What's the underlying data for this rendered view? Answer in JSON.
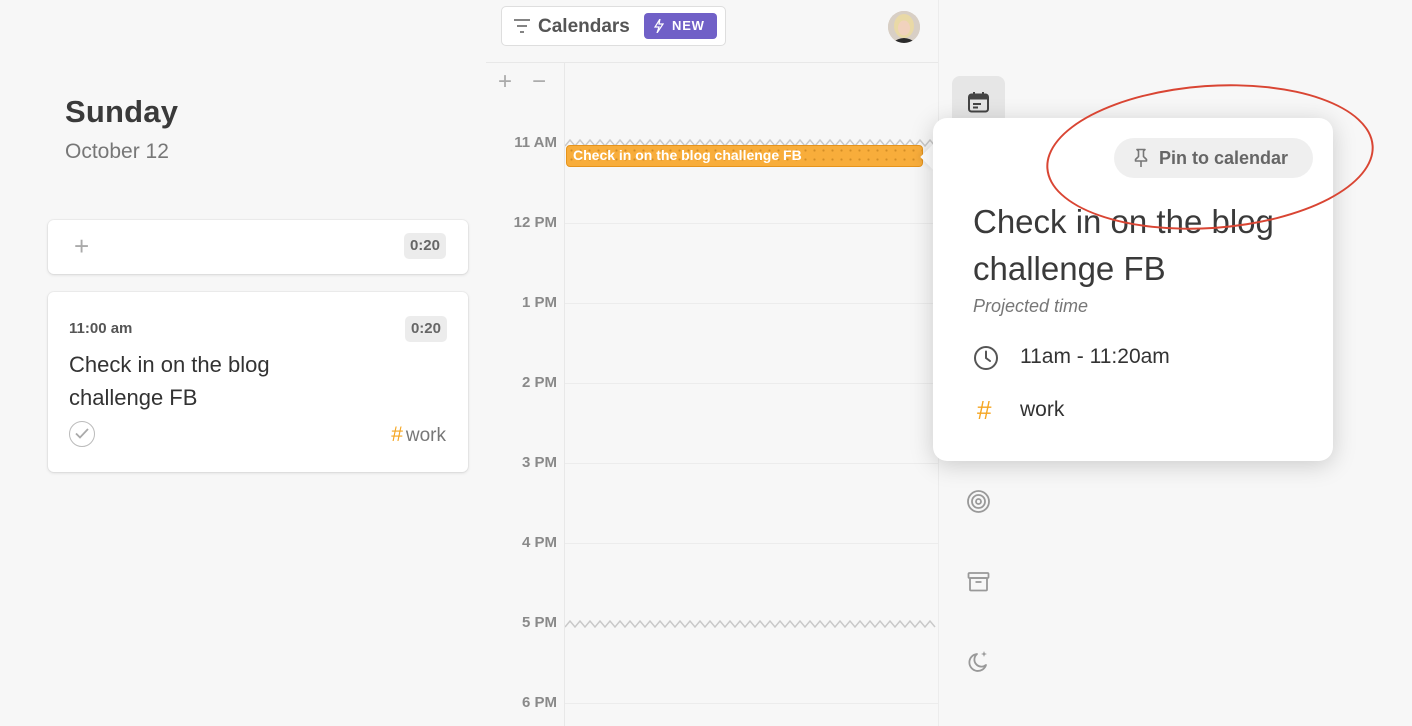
{
  "day": {
    "name": "Sunday",
    "date": "October 12"
  },
  "add_card": {
    "duration": "0:20"
  },
  "task": {
    "time": "11:00 am",
    "duration": "0:20",
    "title": "Check in on the blog challenge FB",
    "tag": "work"
  },
  "toolbar": {
    "calendars_label": "Calendars",
    "new_badge": "NEW"
  },
  "calendar": {
    "zoom_in": "+",
    "zoom_out": "−",
    "hours": [
      "11 AM",
      "12 PM",
      "1 PM",
      "2 PM",
      "3 PM",
      "4 PM",
      "5 PM",
      "6 PM"
    ],
    "event_title": "Check in on the blog challenge FB"
  },
  "popover": {
    "pin_label": "Pin to calendar",
    "title": "Check in on the blog challenge FB",
    "subtitle": "Projected time",
    "time_range": "11am - 11:20am",
    "tag": "work"
  },
  "colors": {
    "accent_orange": "#f5a623",
    "new_badge": "#7060c7",
    "annotation_red": "#d94533"
  }
}
